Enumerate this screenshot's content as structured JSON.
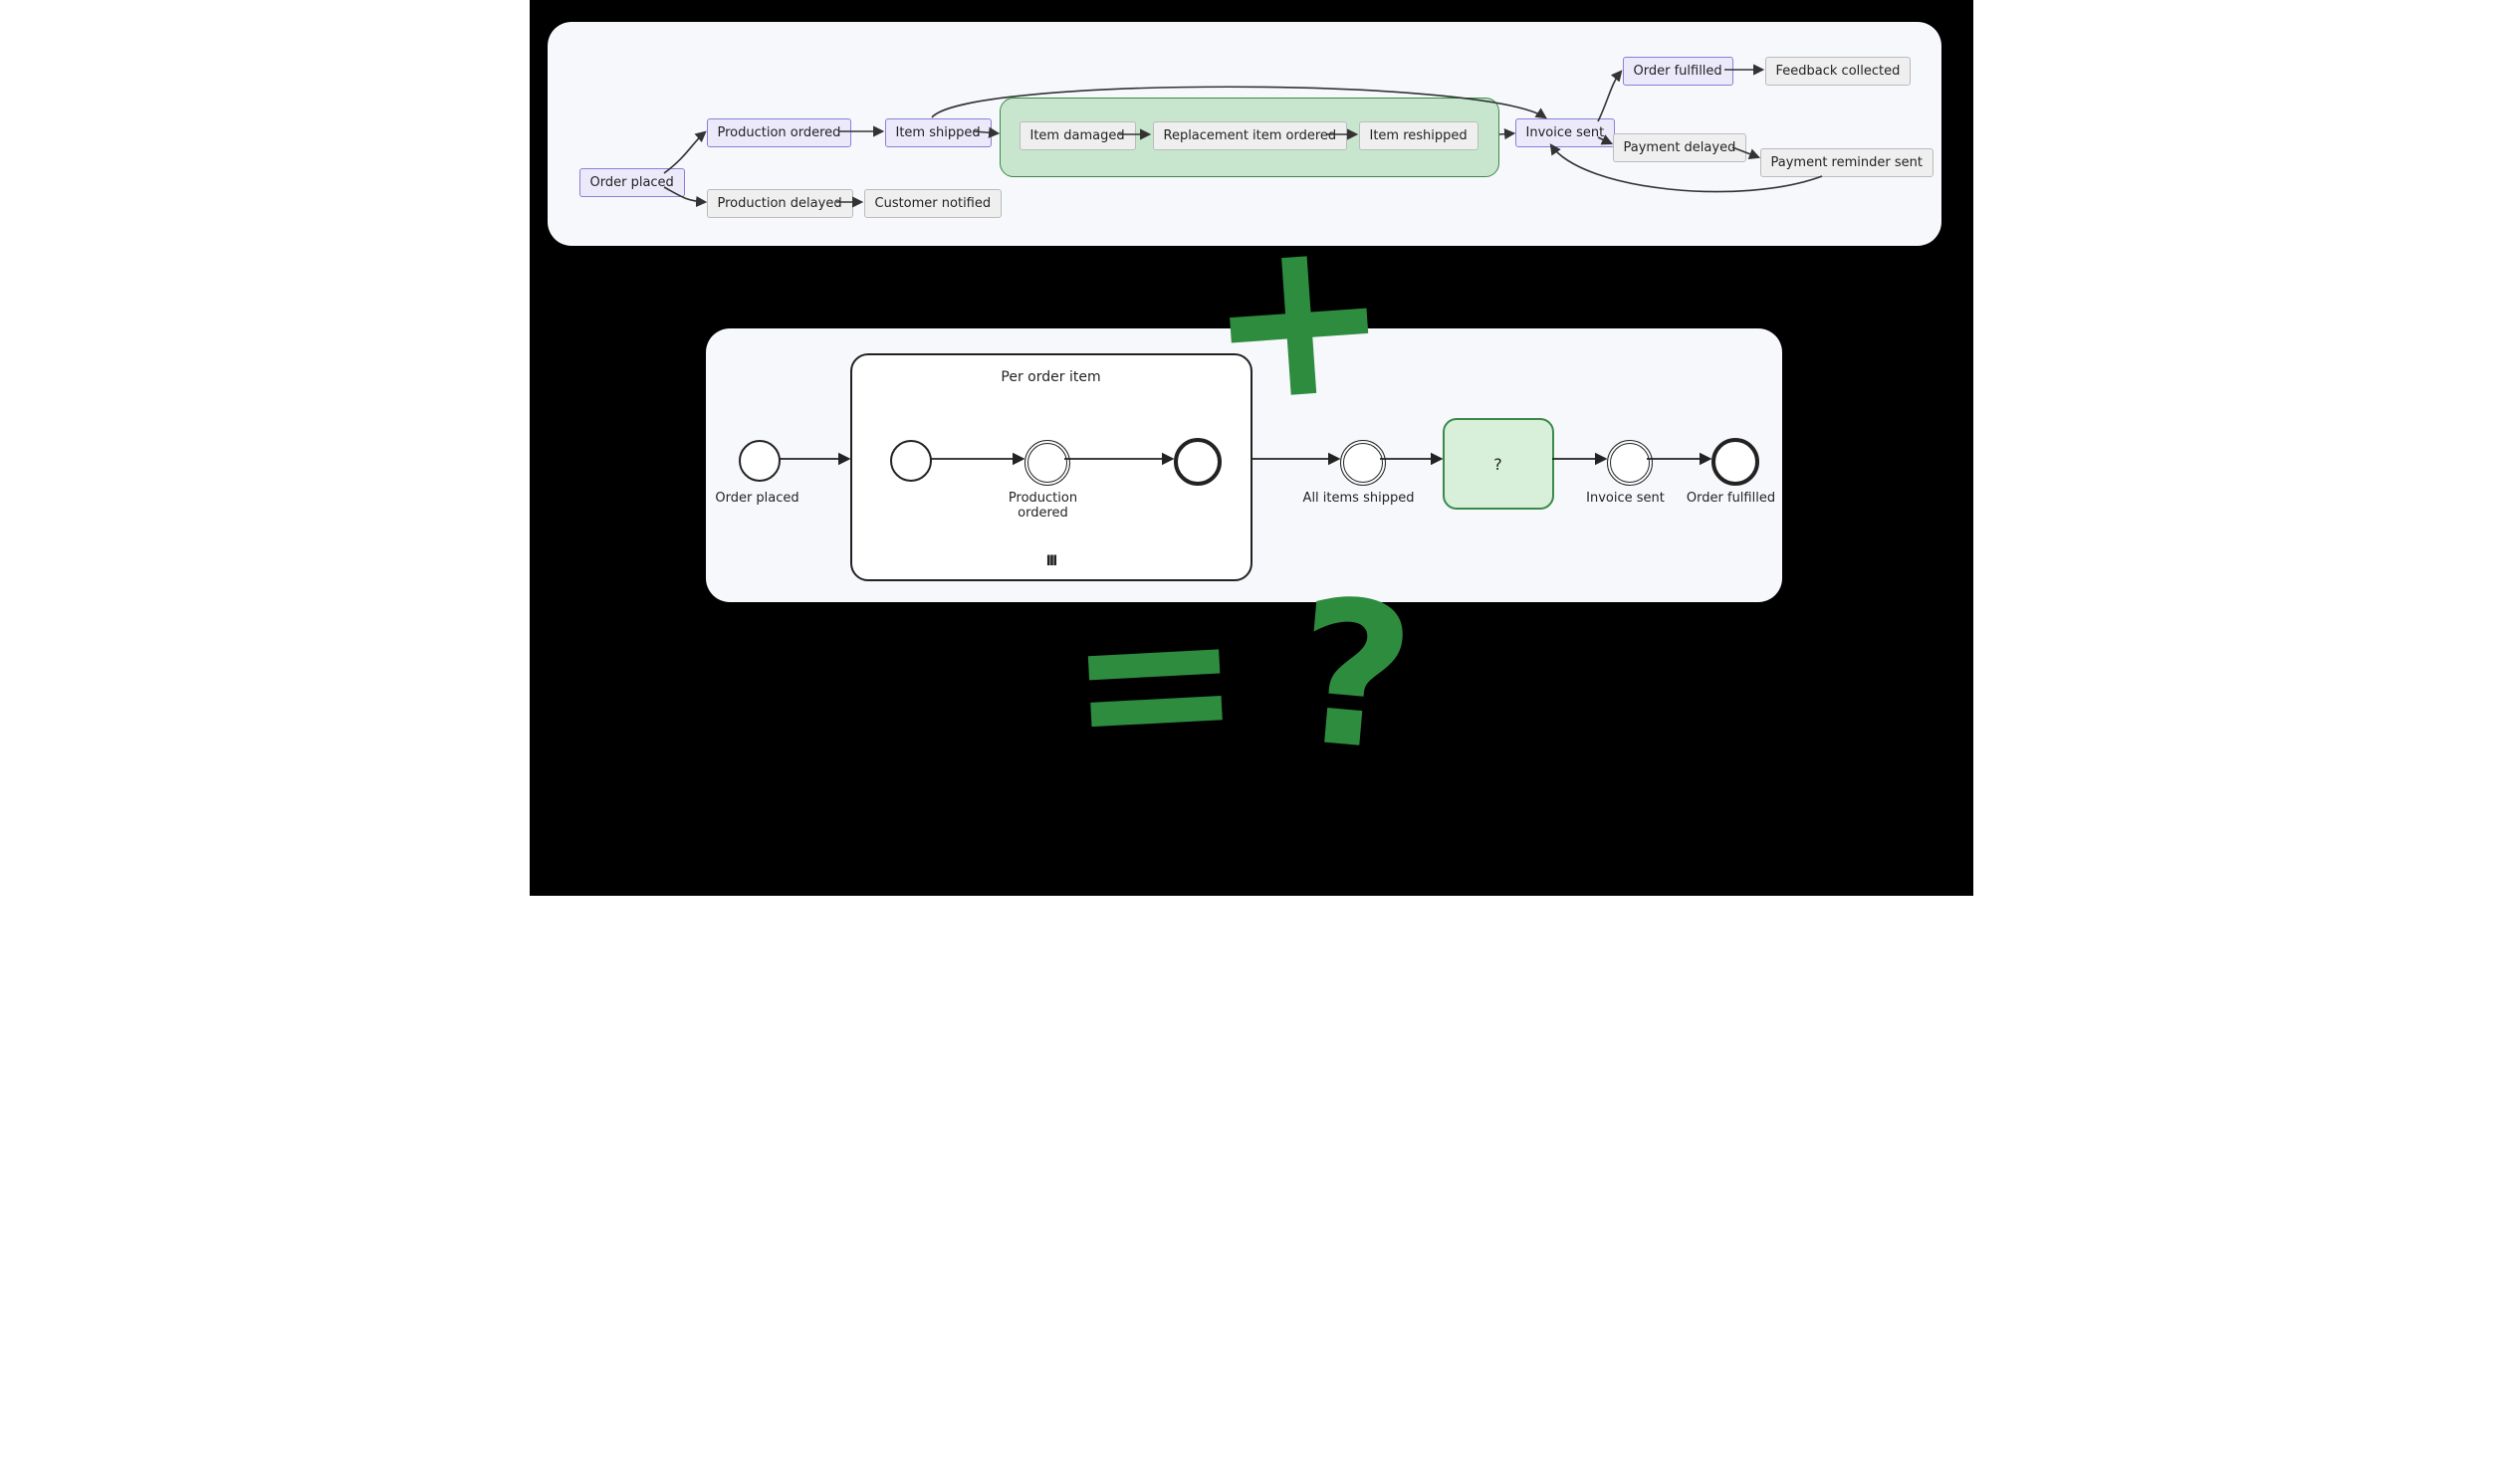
{
  "handdrawn": {
    "plus": "+",
    "equals": "=",
    "question": "?"
  },
  "flow": {
    "order_placed": "Order placed",
    "production_ordered": "Production ordered",
    "production_delayed": "Production delayed",
    "customer_notified": "Customer notified",
    "item_shipped": "Item shipped",
    "item_damaged": "Item damaged",
    "replacement_ordered": "Replacement item ordered",
    "item_reshipped": "Item reshipped",
    "invoice_sent": "Invoice sent",
    "order_fulfilled": "Order fulfilled",
    "feedback_collected": "Feedback collected",
    "payment_delayed": "Payment delayed",
    "payment_reminder": "Payment reminder sent"
  },
  "bpmn": {
    "subprocess_title": "Per order item",
    "subprocess_marker": "III",
    "start_label": "Order placed",
    "prod_label": "Production\nordered",
    "all_shipped_label": "All items shipped",
    "activity_label": "?",
    "invoice_label": "Invoice sent",
    "fulfilled_label": "Order fulfilled"
  }
}
